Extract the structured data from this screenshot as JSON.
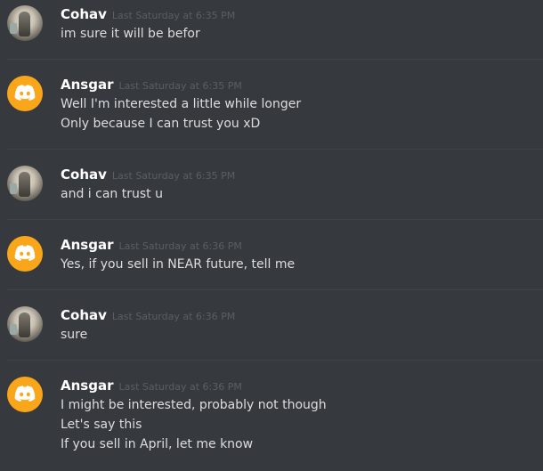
{
  "messages": [
    {
      "author": "Cohav",
      "timestamp": "Last Saturday at 6:35 PM",
      "avatar": "photo-avatar",
      "lines": [
        "im sure it will be befor"
      ]
    },
    {
      "author": "Ansgar",
      "timestamp": "Last Saturday at 6:35 PM",
      "avatar": "discord-logo-avatar",
      "lines": [
        "Well I'm interested a little while longer",
        "Only because I can trust you xD"
      ]
    },
    {
      "author": "Cohav",
      "timestamp": "Last Saturday at 6:35 PM",
      "avatar": "photo-avatar",
      "lines": [
        "and i can trust u"
      ]
    },
    {
      "author": "Ansgar",
      "timestamp": "Last Saturday at 6:36 PM",
      "avatar": "discord-logo-avatar",
      "lines": [
        "Yes, if you sell in NEAR future, tell me"
      ]
    },
    {
      "author": "Cohav",
      "timestamp": "Last Saturday at 6:36 PM",
      "avatar": "photo-avatar",
      "lines": [
        "sure"
      ]
    },
    {
      "author": "Ansgar",
      "timestamp": "Last Saturday at 6:36 PM",
      "avatar": "discord-logo-avatar",
      "lines": [
        "I might be interested, probably not though",
        "Let's say this",
        "If you sell in April, let me know"
      ]
    }
  ],
  "colors": {
    "background": "#36393e",
    "username": "#ffffff",
    "timestamp": "#5b5e63",
    "text": "#dcddde",
    "divider": "#3f4247",
    "discord_avatar": "#faa61a"
  }
}
